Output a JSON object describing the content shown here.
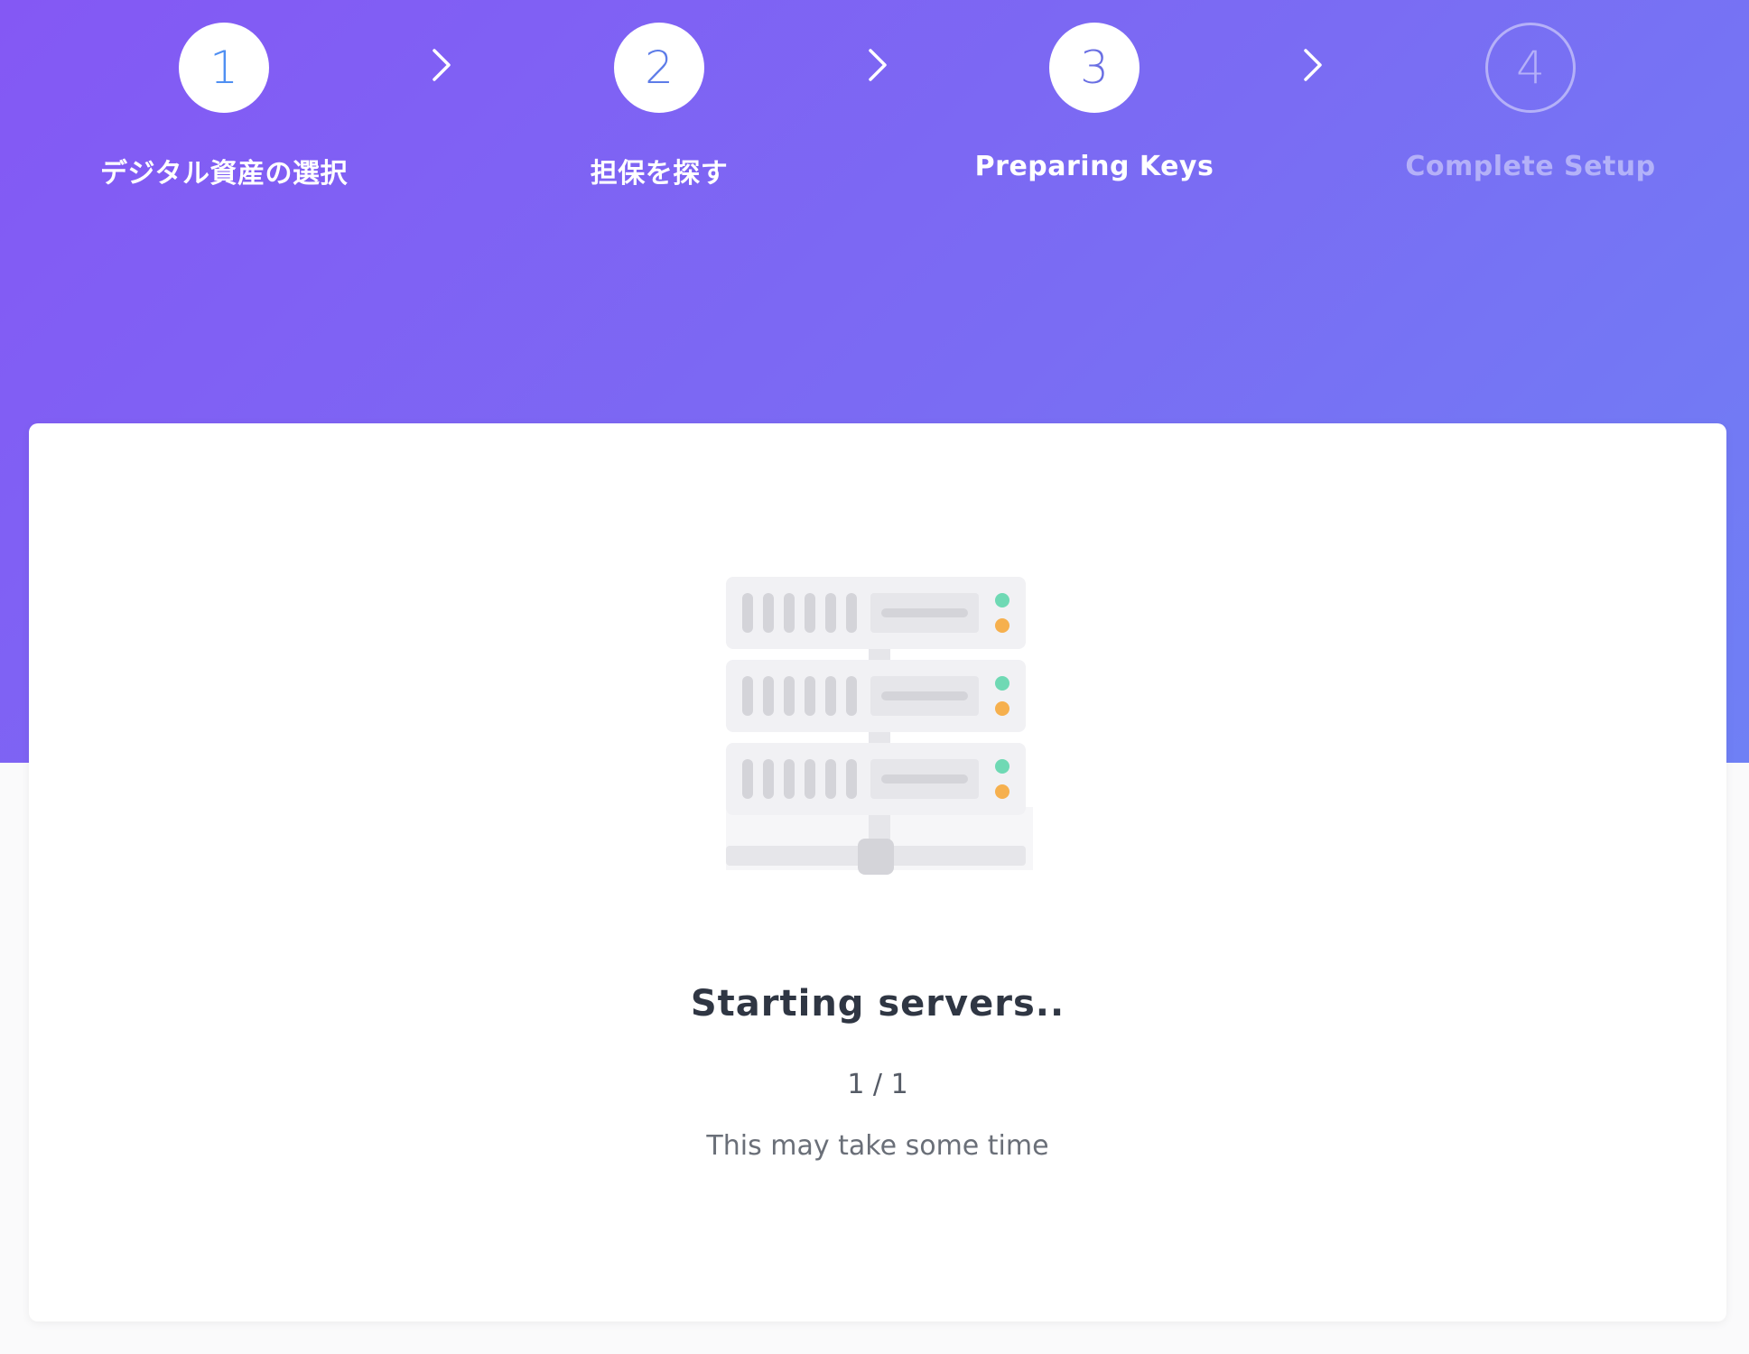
{
  "steps": [
    {
      "number": "1",
      "label": "デジタル資産の選択",
      "state": "done"
    },
    {
      "number": "2",
      "label": "担保を探す",
      "state": "done"
    },
    {
      "number": "3",
      "label": "Preparing Keys",
      "state": "current"
    },
    {
      "number": "4",
      "label": "Complete Setup",
      "state": "pending"
    }
  ],
  "status": {
    "title": "Starting servers..",
    "progress": "1 / 1",
    "note": "This may take some time"
  },
  "icons": {
    "separator": "chevron-right-icon",
    "illustration": "server-rack-icon"
  },
  "colors": {
    "gradient_start": "#8458f4",
    "gradient_end": "#6f80f5",
    "led_green": "#6fd9b4",
    "led_orange": "#f6b04e"
  }
}
